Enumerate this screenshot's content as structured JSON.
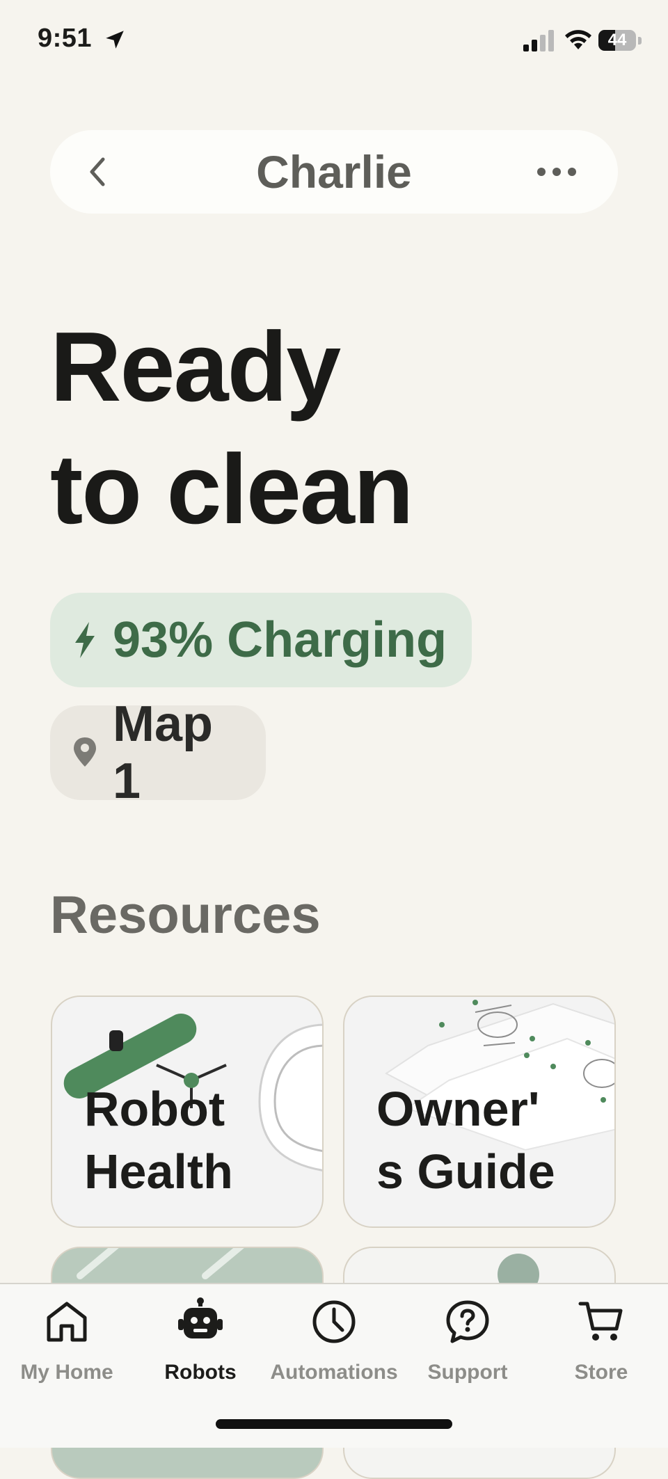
{
  "status_bar": {
    "time": "9:51",
    "battery_level": "44",
    "battery_fraction": 0.44
  },
  "header": {
    "title": "Charlie",
    "back_icon": "chevron-left-icon",
    "more_icon": "ellipsis-icon"
  },
  "status": {
    "line1": "Ready",
    "line2": "to clean"
  },
  "chips": {
    "charging": {
      "text": "93% Charging",
      "icon": "bolt-icon",
      "color": "#3e6b48",
      "background": "#dfeadf"
    },
    "map": {
      "text": "Map 1",
      "icon": "location-pin-icon"
    }
  },
  "resources": {
    "title": "Resources",
    "cards": [
      {
        "label": "Robot Health"
      },
      {
        "label": "Owner's Guide",
        "label_line1": "Owner'",
        "label_line2": "s Guide"
      }
    ]
  },
  "tab_bar": {
    "tabs": [
      {
        "label": "My Home",
        "icon": "home-icon",
        "active": false
      },
      {
        "label": "Robots",
        "icon": "robot-icon",
        "active": true
      },
      {
        "label": "Automations",
        "icon": "clock-icon",
        "active": false
      },
      {
        "label": "Support",
        "icon": "help-icon",
        "active": false
      },
      {
        "label": "Store",
        "icon": "cart-icon",
        "active": false
      }
    ]
  },
  "colors": {
    "background": "#f6f4ee",
    "accent_green": "#3e6b48",
    "text_dark": "#1c1c1a",
    "text_muted": "#8d8d89"
  }
}
